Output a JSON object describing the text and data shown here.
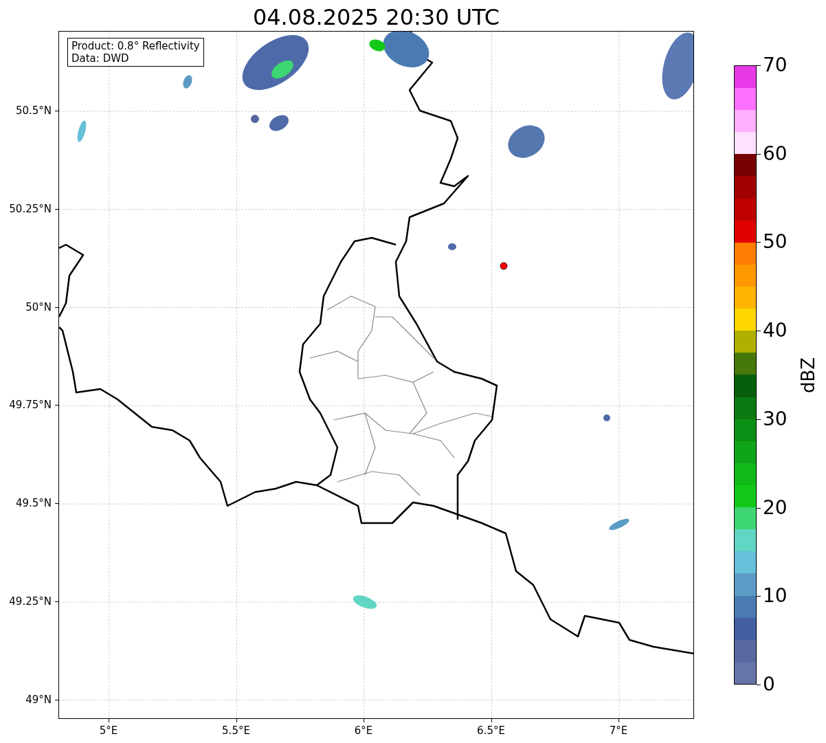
{
  "title": "04.08.2025 20:30 UTC",
  "info_box": [
    "Product: 0.8° Reflectivity",
    "Data: DWD"
  ],
  "y_ticks": [
    "50.5°N",
    "50.25°N",
    "50°N",
    "49.75°N",
    "49.5°N",
    "49.25°N",
    "49°N"
  ],
  "x_ticks": [
    "5°E",
    "5.5°E",
    "6°E",
    "6.5°E",
    "7°E"
  ],
  "colorbar": {
    "label": "dBZ",
    "tick_labels": [
      "70",
      "60",
      "50",
      "40",
      "30",
      "20",
      "10",
      "0"
    ],
    "bins": [
      {
        "color": "#6675a8"
      },
      {
        "color": "#5767a0"
      },
      {
        "color": "#4360a3"
      },
      {
        "color": "#4a7ab2"
      },
      {
        "color": "#5b9bc5"
      },
      {
        "color": "#66c0d9"
      },
      {
        "color": "#62d6c4"
      },
      {
        "color": "#3dd672"
      },
      {
        "color": "#12c918"
      },
      {
        "color": "#10b818"
      },
      {
        "color": "#0fa518"
      },
      {
        "color": "#0b8f14"
      },
      {
        "color": "#0b7a10"
      },
      {
        "color": "#075f0c"
      },
      {
        "color": "#47780a"
      },
      {
        "color": "#b0b000"
      },
      {
        "color": "#ffd700"
      },
      {
        "color": "#ffb400"
      },
      {
        "color": "#ff9900"
      },
      {
        "color": "#ff7d00"
      },
      {
        "color": "#e00000"
      },
      {
        "color": "#c00000"
      },
      {
        "color": "#a00000"
      },
      {
        "color": "#780000"
      },
      {
        "color": "#ffe0ff"
      },
      {
        "color": "#ffb0ff"
      },
      {
        "color": "#ff70ff"
      },
      {
        "color": "#e838e8"
      }
    ]
  }
}
